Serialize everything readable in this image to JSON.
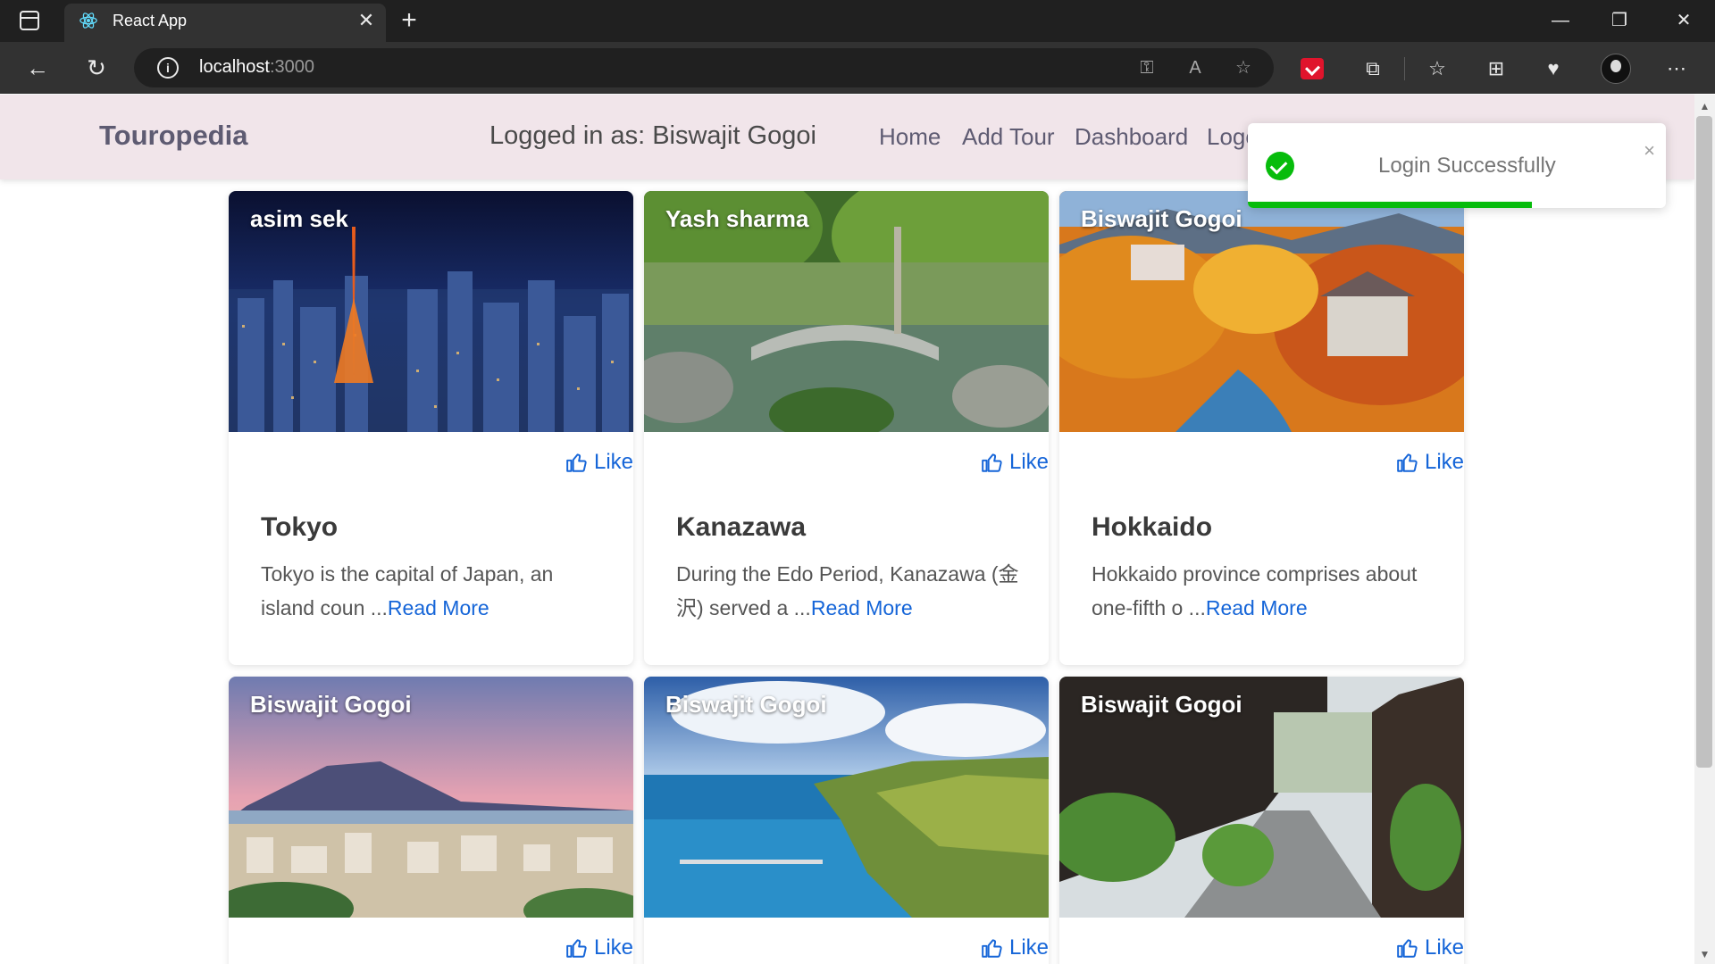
{
  "browser": {
    "tab_title": "React App",
    "tab_close": "✕",
    "new_tab": "+",
    "url_host": "localhost",
    "url_port": ":3000",
    "info_icon": "i",
    "window": {
      "minimize": "—",
      "maximize": "❐",
      "close": "✕"
    },
    "icons": {
      "back": "←",
      "reload": "↻",
      "key": "⚿",
      "read_aloud": "A",
      "favorite_add": "☆",
      "extensions": "⧉",
      "favorites": "☆",
      "collections": "⊞",
      "health": "♥",
      "more": "⋯"
    }
  },
  "navbar": {
    "brand": "Touropedia",
    "logged_in": "Logged in as: Biswajit Gogoi",
    "links": [
      "Home",
      "Add Tour",
      "Dashboard",
      "Logout"
    ]
  },
  "toast": {
    "message": "Login Successfully",
    "close": "×",
    "progress": 0.68,
    "color": "#07bc0c"
  },
  "tours": [
    {
      "author": "asim sek",
      "title": "Tokyo",
      "excerpt": "Tokyo is the capital of Japan, an island coun ...",
      "read_more": "Read More",
      "like": "Like"
    },
    {
      "author": "Yash sharma",
      "title": "Kanazawa",
      "excerpt": "During the Edo Period, Kanazawa (金沢) served a ...",
      "read_more": "Read More",
      "like": "Like"
    },
    {
      "author": "Biswajit Gogoi",
      "title": "Hokkaido",
      "excerpt": "Hokkaido province comprises about one-fifth o ...",
      "read_more": "Read More",
      "like": "Like"
    },
    {
      "author": "Biswajit Gogoi",
      "title": "",
      "excerpt": "",
      "read_more": "",
      "like": "Like"
    },
    {
      "author": "Biswajit Gogoi",
      "title": "",
      "excerpt": "",
      "read_more": "",
      "like": "Like"
    },
    {
      "author": "Biswajit Gogoi",
      "title": "",
      "excerpt": "",
      "read_more": "",
      "like": "Like"
    }
  ],
  "colors": {
    "navbar_bg": "#f1e5ea",
    "brand": "#5e5b72",
    "link": "#1565d8"
  }
}
